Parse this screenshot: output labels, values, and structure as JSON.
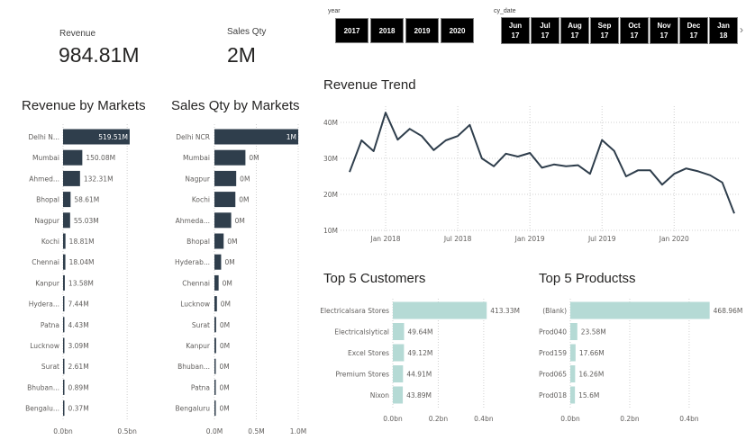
{
  "kpis": {
    "revenue": {
      "label": "Revenue",
      "value": "984.81M"
    },
    "sales_qty": {
      "label": "Sales Qty",
      "value": "2M"
    }
  },
  "slicers": {
    "year": {
      "title": "year",
      "options": [
        "2017",
        "2018",
        "2019",
        "2020"
      ]
    },
    "cy_date": {
      "title": "cy_date",
      "options": [
        {
          "month": "Jun",
          "year": "17"
        },
        {
          "month": "Jul",
          "year": "17"
        },
        {
          "month": "Aug",
          "year": "17"
        },
        {
          "month": "Sep",
          "year": "17"
        },
        {
          "month": "Oct",
          "year": "17"
        },
        {
          "month": "Nov",
          "year": "17"
        },
        {
          "month": "Dec",
          "year": "17"
        },
        {
          "month": "Jan",
          "year": "18"
        }
      ],
      "next_arrow": "chevron-right-icon"
    }
  },
  "colors": {
    "dark_bar": "#2f3e4c",
    "light_bar": "#b5dad5",
    "line": "#2f3e4c",
    "grid": "#d0d0d0",
    "axis_text": "#605e5c"
  },
  "chart_data": [
    {
      "id": "revenue_by_markets",
      "type": "bar",
      "orientation": "horizontal",
      "title": "Revenue by Markets",
      "categories": [
        "Delhi N...",
        "Mumbai",
        "Ahmed...",
        "Bhopal",
        "Nagpur",
        "Kochi",
        "Chennai",
        "Kanpur",
        "Hydera...",
        "Patna",
        "Lucknow",
        "Surat",
        "Bhuban...",
        "Bengalu..."
      ],
      "values": [
        519.51,
        150.08,
        132.31,
        58.61,
        55.03,
        18.81,
        18.04,
        13.58,
        7.44,
        4.43,
        3.09,
        2.61,
        0.89,
        0.37
      ],
      "data_labels": [
        "519.51M",
        "150.08M",
        "132.31M",
        "58.61M",
        "55.03M",
        "18.81M",
        "18.04M",
        "13.58M",
        "7.44M",
        "4.43M",
        "3.09M",
        "2.61M",
        "0.89M",
        "0.37M"
      ],
      "xlim": [
        0,
        520
      ],
      "ticks": [
        {
          "v": 0,
          "label": "0.0bn"
        },
        {
          "v": 500,
          "label": "0.5bn"
        }
      ],
      "grid": true
    },
    {
      "id": "sales_qty_by_markets",
      "type": "bar",
      "orientation": "horizontal",
      "title": "Sales Qty by Markets",
      "categories": [
        "Delhi NCR",
        "Mumbai",
        "Nagpur",
        "Kochi",
        "Ahmeda...",
        "Bhopal",
        "Hyderab...",
        "Chennai",
        "Lucknow",
        "Surat",
        "Kanpur",
        "Bhuban...",
        "Patna",
        "Bengaluru"
      ],
      "values": [
        1.0,
        0.37,
        0.26,
        0.25,
        0.2,
        0.11,
        0.08,
        0.05,
        0.03,
        0.02,
        0.02,
        0.01,
        0.01,
        0.004
      ],
      "data_labels": [
        "1M",
        "0M",
        "0M",
        "0M",
        "0M",
        "0M",
        "0M",
        "0M",
        "0M",
        "0M",
        "0M",
        "0M",
        "0M",
        "0M"
      ],
      "xlim": [
        0,
        1.0
      ],
      "ticks": [
        {
          "v": 0,
          "label": "0.0M"
        },
        {
          "v": 0.5,
          "label": "0.5M"
        },
        {
          "v": 1.0,
          "label": "1.0M"
        }
      ],
      "grid": true
    },
    {
      "id": "revenue_trend",
      "type": "line",
      "title": "Revenue Trend",
      "x": [
        "2017-10",
        "2017-11",
        "2017-12",
        "2018-01",
        "2018-02",
        "2018-03",
        "2018-04",
        "2018-05",
        "2018-06",
        "2018-07",
        "2018-08",
        "2018-09",
        "2018-10",
        "2018-11",
        "2018-12",
        "2019-01",
        "2019-02",
        "2019-03",
        "2019-04",
        "2019-05",
        "2019-06",
        "2019-07",
        "2019-08",
        "2019-09",
        "2019-10",
        "2019-11",
        "2019-12",
        "2020-01",
        "2020-02",
        "2020-03",
        "2020-04",
        "2020-05",
        "2020-06"
      ],
      "values": [
        26.2,
        35,
        32,
        42.7,
        35.2,
        38.2,
        36.2,
        32.3,
        35,
        36.2,
        39.3,
        30,
        27.8,
        31.3,
        30.5,
        31.5,
        27.4,
        28.3,
        27.8,
        28.1,
        25.7,
        35.1,
        32.1,
        25,
        26.7,
        26.7,
        22.7,
        25.7,
        27.2,
        26.4,
        25.3,
        23.3,
        14.7
      ],
      "ylim": [
        10,
        44
      ],
      "yticks": [
        {
          "v": 10,
          "label": "10M"
        },
        {
          "v": 20,
          "label": "20M"
        },
        {
          "v": 30,
          "label": "30M"
        },
        {
          "v": 40,
          "label": "40M"
        }
      ],
      "xticks": [
        {
          "i": 3,
          "label": "Jan 2018"
        },
        {
          "i": 9,
          "label": "Jul 2018"
        },
        {
          "i": 15,
          "label": "Jan 2019"
        },
        {
          "i": 21,
          "label": "Jul 2019"
        },
        {
          "i": 27,
          "label": "Jan 2020"
        }
      ],
      "grid": true
    },
    {
      "id": "top5_customers",
      "type": "bar",
      "orientation": "horizontal",
      "title": "Top 5 Customers",
      "categories": [
        "Electricalsara Stores",
        "Electricalslytical",
        "Excel Stores",
        "Premium Stores",
        "Nixon"
      ],
      "values": [
        413.33,
        49.64,
        49.12,
        44.91,
        43.89
      ],
      "data_labels": [
        "413.33M",
        "49.64M",
        "49.12M",
        "44.91M",
        "43.89M"
      ],
      "xlim": [
        0,
        460
      ],
      "ticks": [
        {
          "v": 0,
          "label": "0.0bn"
        },
        {
          "v": 200,
          "label": "0.2bn"
        },
        {
          "v": 400,
          "label": "0.4bn"
        }
      ],
      "grid": true
    },
    {
      "id": "top5_products",
      "type": "bar",
      "orientation": "horizontal",
      "title": "Top 5 Productss",
      "categories": [
        "(Blank)",
        "Prod040",
        "Prod159",
        "Prod065",
        "Prod018"
      ],
      "values": [
        468.96,
        23.58,
        17.66,
        16.26,
        15.6
      ],
      "data_labels": [
        "468.96M",
        "23.58M",
        "17.66M",
        "16.26M",
        "15.6M"
      ],
      "xlim": [
        0,
        470
      ],
      "ticks": [
        {
          "v": 0,
          "label": "0.0bn"
        },
        {
          "v": 200,
          "label": "0.2bn"
        },
        {
          "v": 400,
          "label": "0.4bn"
        }
      ],
      "grid": true
    }
  ]
}
